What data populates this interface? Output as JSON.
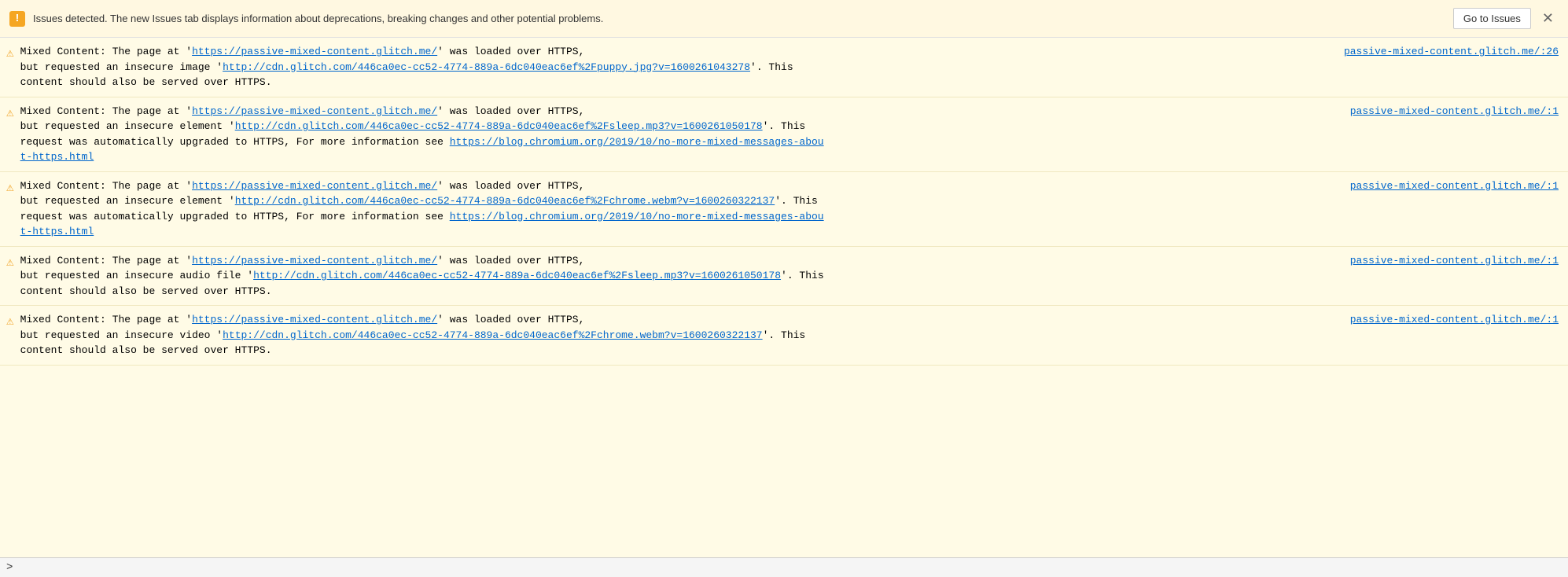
{
  "banner": {
    "icon": "⚠",
    "text": "Issues detected. The new Issues tab displays information about deprecations, breaking changes and other potential problems.",
    "button_label": "Go to Issues",
    "close_label": "✕"
  },
  "messages": [
    {
      "id": 1,
      "prefix": "Mixed Content: The page at '",
      "page_url": "https://passive-mixed-content.glitch.me/",
      "mid1": "' was loaded over HTTPS,",
      "source": "passive-mixed-content.glitch.me/:26",
      "line2_pre": "but requested an insecure image '",
      "resource_url": "http://cdn.glitch.com/446ca0ec-cc52-4774-889a-6dc040eac6ef%2Fpuppy.jpg?v=1600261043278",
      "line2_post": "'. This",
      "line3": "content should also be served over HTTPS."
    },
    {
      "id": 2,
      "prefix": "Mixed Content: The page at '",
      "page_url": "https://passive-mixed-content.glitch.me/",
      "mid1": "' was loaded over HTTPS,",
      "source": "passive-mixed-content.glitch.me/:1",
      "line2_pre": "but requested an insecure element '",
      "resource_url": "http://cdn.glitch.com/446ca0ec-cc52-4774-889a-6dc040eac6ef%2Fsleep.mp3?v=1600261050178",
      "line2_post": "'. This",
      "line3_pre": "request was automatically upgraded to HTTPS, For more information see ",
      "info_url": "https://blog.chromium.org/2019/10/no-more-mixed-messages-about-https.html",
      "info_url_text": "https://blog.chromium.org/2019/10/no-more-mixed-messages-abou",
      "info_url_line2": "t-https.html",
      "has_info_link": true
    },
    {
      "id": 3,
      "prefix": "Mixed Content: The page at '",
      "page_url": "https://passive-mixed-content.glitch.me/",
      "mid1": "' was loaded over HTTPS,",
      "source": "passive-mixed-content.glitch.me/:1",
      "line2_pre": "but requested an insecure element '",
      "resource_url": "http://cdn.glitch.com/446ca0ec-cc52-4774-889a-6dc040eac6ef%2Fchrome.webm?v=1600260322137",
      "line2_post": "'. This",
      "line3_pre": "request was automatically upgraded to HTTPS, For more information see ",
      "info_url": "https://blog.chromium.org/2019/10/no-more-mixed-messages-about-https.html",
      "info_url_text": "https://blog.chromium.org/2019/10/no-more-mixed-messages-abou",
      "info_url_line2": "t-https.html",
      "has_info_link": true
    },
    {
      "id": 4,
      "prefix": "Mixed Content: The page at '",
      "page_url": "https://passive-mixed-content.glitch.me/",
      "mid1": "' was loaded over HTTPS,",
      "source": "passive-mixed-content.glitch.me/:1",
      "line2_pre": "but requested an insecure audio file '",
      "resource_url": "http://cdn.glitch.com/446ca0ec-cc52-4774-889a-6dc040eac6ef%2Fsleep.mp3?v=1600261050178",
      "line2_post": "'. This",
      "line3": "content should also be served over HTTPS.",
      "has_info_link": false
    },
    {
      "id": 5,
      "prefix": "Mixed Content: The page at '",
      "page_url": "https://passive-mixed-content.glitch.me/",
      "mid1": "' was loaded over HTTPS,",
      "source": "passive-mixed-content.glitch.me/:1",
      "line2_pre": "but requested an insecure video '",
      "resource_url": "http://cdn.glitch.com/446ca0ec-cc52-4774-889a-6dc040eac6ef%2Fchrome.webm?v=1600260322137",
      "line2_post": "'. This",
      "line3": "content should also be served over HTTPS.",
      "has_info_link": false
    }
  ],
  "bottom_bar": {
    "chevron": ">"
  }
}
